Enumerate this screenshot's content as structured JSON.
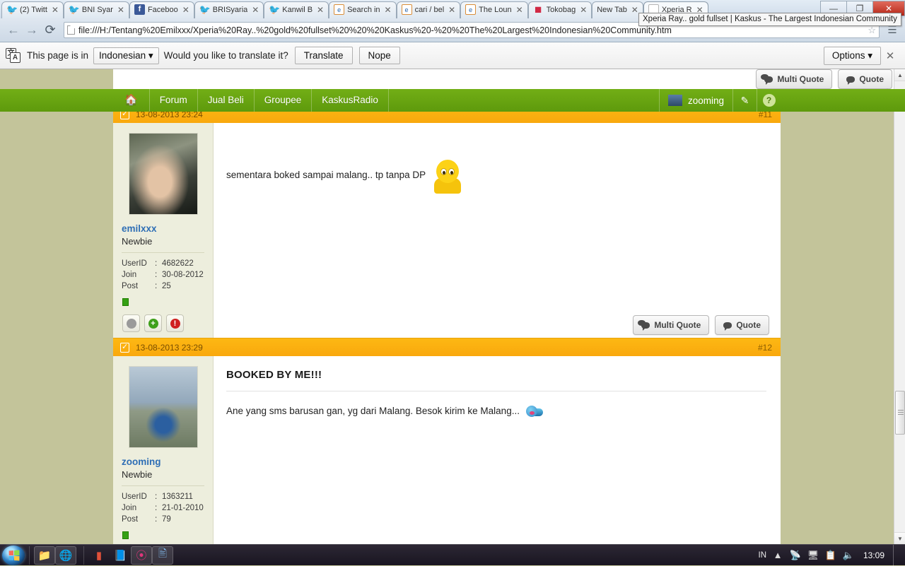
{
  "browser": {
    "tabs": [
      {
        "label": "(2) Twitt",
        "icon": "twitter-icon",
        "active": false
      },
      {
        "label": "BNI Syar",
        "icon": "twitter-icon",
        "active": false
      },
      {
        "label": "Faceboo",
        "icon": "facebook-icon",
        "active": false
      },
      {
        "label": "BRISyaria",
        "icon": "twitter-icon",
        "active": false
      },
      {
        "label": "Kanwil B",
        "icon": "twitter-icon",
        "active": false
      },
      {
        "label": "Search in",
        "icon": "ie-icon",
        "active": false
      },
      {
        "label": "cari / bel",
        "icon": "ie-icon",
        "active": false
      },
      {
        "label": "The Loun",
        "icon": "ie-icon",
        "active": false
      },
      {
        "label": "Tokobag",
        "icon": "tokopedia-icon",
        "active": false
      },
      {
        "label": "New Tab",
        "icon": "blank-icon",
        "active": false
      },
      {
        "label": "Xperia R",
        "icon": "document-icon",
        "active": true
      }
    ],
    "tab_tooltip": "Xperia Ray.. gold fullset | Kaskus - The Largest Indonesian Community",
    "window_buttons": {
      "minimize": "—",
      "maximize": "❐",
      "close": "✕"
    },
    "nav": {
      "back": "←",
      "forward": "→",
      "reload": "⟳"
    },
    "url": "file:///H:/Tentang%20Emilxxx/Xperia%20Ray..%20gold%20fullset%20%20%20Kaskus%20-%20%20The%20Largest%20Indonesian%20Community.htm",
    "bookmark_star": "☆",
    "menu": "☰"
  },
  "translate_bar": {
    "prefix": "This page is in",
    "language": "Indonesian",
    "language_caret": "▾",
    "question": "Would you like to translate it?",
    "translate_label": "Translate",
    "nope_label": "Nope",
    "options_label": "Options",
    "options_caret": "▾",
    "close_label": "✕"
  },
  "site_nav": {
    "home_icon": "home-icon",
    "items": [
      "Forum",
      "Jual Beli",
      "Groupee",
      "KaskusRadio"
    ],
    "username": "zooming",
    "compose_icon": "pencil-icon",
    "help_icon": "question-mark-icon"
  },
  "quote_buttons": {
    "multi_quote": "Multi Quote",
    "quote": "Quote"
  },
  "posts": [
    {
      "timestamp": "13-08-2013 23:24",
      "number": "#11",
      "user": {
        "name": "emilxxx",
        "rank": "Newbie",
        "userid_label": "UserID",
        "userid": "4682622",
        "join_label": "Join",
        "join": "30-08-2012",
        "post_label": "Post",
        "post": "25"
      },
      "title": "",
      "text": "sementara boked sampai malang.. tp tanpa DP",
      "smiley": "sad-yellow-smiley"
    },
    {
      "timestamp": "13-08-2013 23:29",
      "number": "#12",
      "user": {
        "name": "zooming",
        "rank": "Newbie",
        "userid_label": "UserID",
        "userid": "1363211",
        "join_label": "Join",
        "join": "21-01-2010",
        "post_label": "Post",
        "post": "79"
      },
      "title": "BOOKED BY ME!!!",
      "text": "Ane yang sms barusan gan, yg dari Malang. Besok kirim ke Malang...",
      "smiley": "blue-kiss-smiley"
    }
  ],
  "taskbar": {
    "start_label": "Start",
    "pinned": [
      "explorer-icon",
      "chrome-icon"
    ],
    "running": [
      "pdf-icon",
      "book-icon",
      "opera-icon",
      "contacts-icon"
    ],
    "tray": {
      "language": "IN",
      "show_hidden": "▲",
      "icons": [
        "network-error-icon",
        "monitor-icon",
        "action-center-icon",
        "volume-muted-icon"
      ],
      "clock": "13:09"
    }
  }
}
